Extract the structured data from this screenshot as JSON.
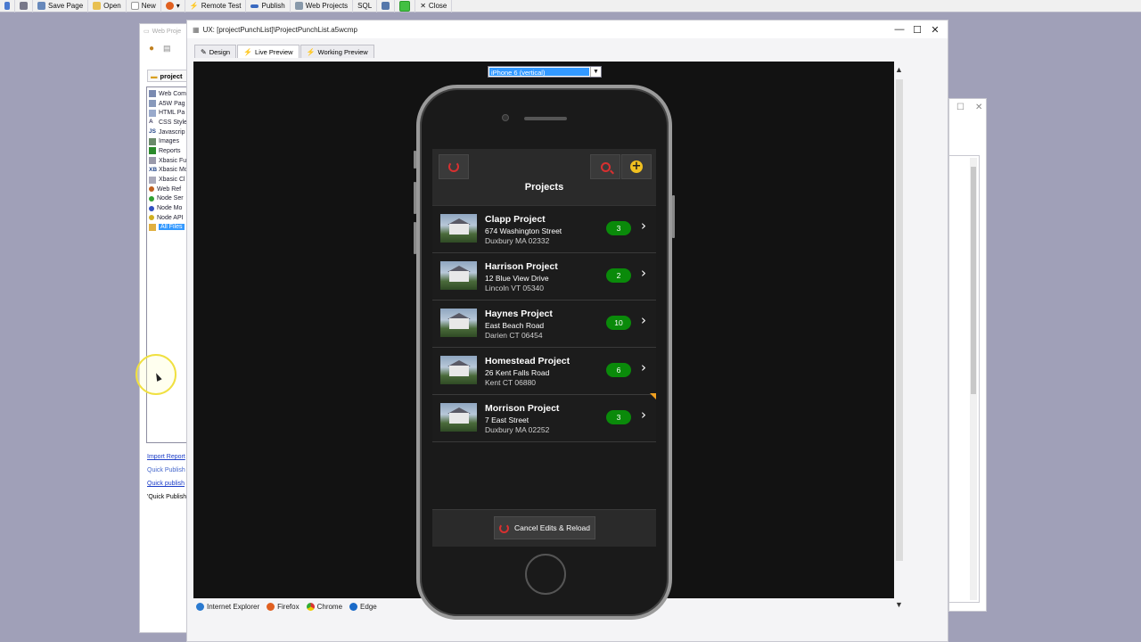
{
  "toolbar": {
    "items": [
      {
        "label": "Save Page",
        "icon": "save-icon"
      },
      {
        "label": "Open",
        "icon": "open-folder-icon"
      },
      {
        "label": "New",
        "icon": "new-file-icon"
      },
      {
        "label": "Remote Test",
        "icon": "lightning-icon"
      },
      {
        "label": "Publish",
        "icon": "publish-icon"
      },
      {
        "label": "Web Projects",
        "icon": "web-projects-icon"
      },
      {
        "label": "SQL",
        "icon": "sql-icon"
      },
      {
        "label": "Close",
        "icon": "close-icon"
      }
    ]
  },
  "bg_window": {
    "title": "Web Proje",
    "tab_label": "project",
    "tree_items": [
      {
        "label": "Web Com",
        "icon": "web-component-icon"
      },
      {
        "label": "A5W Pag",
        "icon": "a5w-page-icon"
      },
      {
        "label": "HTML Pa",
        "icon": "html-page-icon"
      },
      {
        "label": "CSS Style",
        "icon": "css-icon"
      },
      {
        "label": "Javascrip",
        "icon": "js-icon"
      },
      {
        "label": "Images",
        "icon": "images-icon"
      },
      {
        "label": "Reports",
        "icon": "reports-icon"
      },
      {
        "label": "Xbasic Fu",
        "icon": "xbasic-function-icon"
      },
      {
        "label": "Xbasic Mo",
        "icon": "xbasic-module-icon"
      },
      {
        "label": "Xbasic Cl",
        "icon": "xbasic-class-icon"
      },
      {
        "label": "Web Ref",
        "icon": "web-ref-icon"
      },
      {
        "label": "Node Ser",
        "icon": "node-service-icon"
      },
      {
        "label": "Node Mo",
        "icon": "node-module-icon"
      },
      {
        "label": "Node API",
        "icon": "node-api-icon"
      },
      {
        "label": "All Files",
        "icon": "folder-icon"
      }
    ],
    "links": [
      "Import Report",
      "Quick Publish",
      "Quick publish",
      "'Quick Publish"
    ]
  },
  "main_window": {
    "title": "UX: [projectPunchList]\\ProjectPunchList.a5wcmp",
    "tabs": [
      {
        "label": "Design",
        "icon": "design-icon"
      },
      {
        "label": "Live Preview",
        "icon": "lightning-icon"
      },
      {
        "label": "Working Preview",
        "icon": "lightning-icon"
      }
    ],
    "device_select": "iPhone 6 (vertical)",
    "browsers": [
      "Internet Explorer",
      "Firefox",
      "Chrome",
      "Edge"
    ]
  },
  "app": {
    "title": "Projects",
    "projects": [
      {
        "name": "Clapp Project",
        "street": "674 Washington Street",
        "city": "Duxbury MA 02332",
        "count": "3"
      },
      {
        "name": "Harrison Project",
        "street": "12 Blue View Drive",
        "city": "Lincoln VT 05340",
        "count": "2"
      },
      {
        "name": "Haynes Project",
        "street": "East Beach Road",
        "city": "Darien CT 06454",
        "count": "10"
      },
      {
        "name": "Homestead Project",
        "street": "26 Kent Falls Road",
        "city": "Kent CT 06880",
        "count": "6"
      },
      {
        "name": "Morrison Project",
        "street": "7 East Street",
        "city": "Duxbury MA 02252",
        "count": "3"
      }
    ],
    "cancel_label": "Cancel Edits & Reload"
  },
  "colors": {
    "badge": "#0a8a0a",
    "accent_red": "#d83030",
    "add_yellow": "#f0c020",
    "highlight": "#3399ff"
  }
}
